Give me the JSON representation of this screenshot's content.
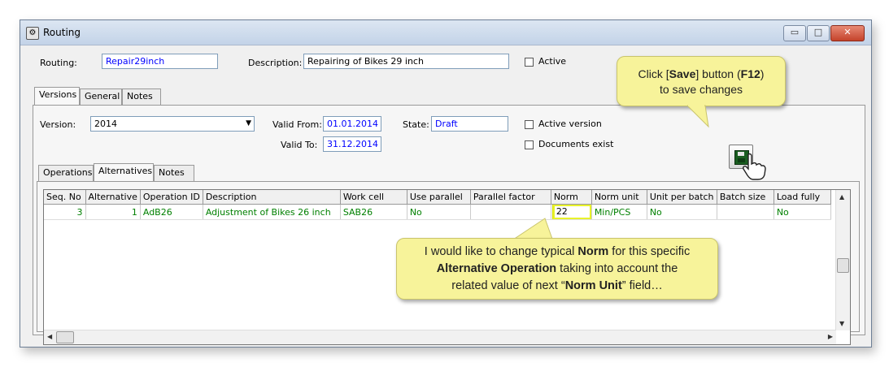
{
  "window": {
    "title": "Routing",
    "buttons": {
      "minimize": "▭",
      "maximize": "□",
      "close": "✕"
    }
  },
  "routing": {
    "label": "Routing:",
    "value": "Repair29inch",
    "description_label": "Description:",
    "description_value": "Repairing of Bikes 29 inch",
    "active_label": "Active"
  },
  "top_tabs": [
    "Versions",
    "General",
    "Notes"
  ],
  "version": {
    "label": "Version:",
    "value": "2014",
    "valid_from_label": "Valid From:",
    "valid_from": "01.01.2014",
    "valid_to_label": "Valid To:",
    "valid_to": "31.12.2014",
    "state_label": "State:",
    "state": "Draft",
    "active_version_label": "Active version",
    "documents_exist_label": "Documents exist"
  },
  "inner_tabs": [
    "Operations",
    "Alternatives",
    "Notes"
  ],
  "grid": {
    "columns": [
      "Seq. No",
      "Alternative",
      "Operation ID",
      "Description",
      "Work cell",
      "Use parallel",
      "Parallel factor",
      "Norm",
      "Norm unit",
      "Unit per batch",
      "Batch size",
      "Load fully"
    ],
    "rows": [
      [
        "3",
        "1",
        "AdB26",
        "Adjustment of Bikes 26 inch",
        "SAB26",
        "No",
        "",
        "22",
        "Min/PCS",
        "No",
        "",
        "No"
      ]
    ]
  },
  "callout_save": {
    "line1_a": "Click [",
    "line1_b": "Save",
    "line1_c": "] button (",
    "line1_d": "F12",
    "line1_e": ")",
    "line2": "to save changes"
  },
  "callout_norm": {
    "l1_a": "I would like to change typical ",
    "l1_b": "Norm",
    "l1_c": " for this specific",
    "l2_a": "Alternative Operation",
    "l2_b": " taking into account the",
    "l3_a": "related value of next “",
    "l3_b": "Norm Unit",
    "l3_c": "” field…"
  },
  "colors": {
    "grid_text": "#008000",
    "field_text": "#0000ff",
    "callout_bg": "#f7f39a",
    "highlight": "#e8f22a"
  },
  "icons": {
    "save": "save-disk-icon",
    "cursor": "hand-pointer-icon",
    "app": "routing-app-icon"
  }
}
